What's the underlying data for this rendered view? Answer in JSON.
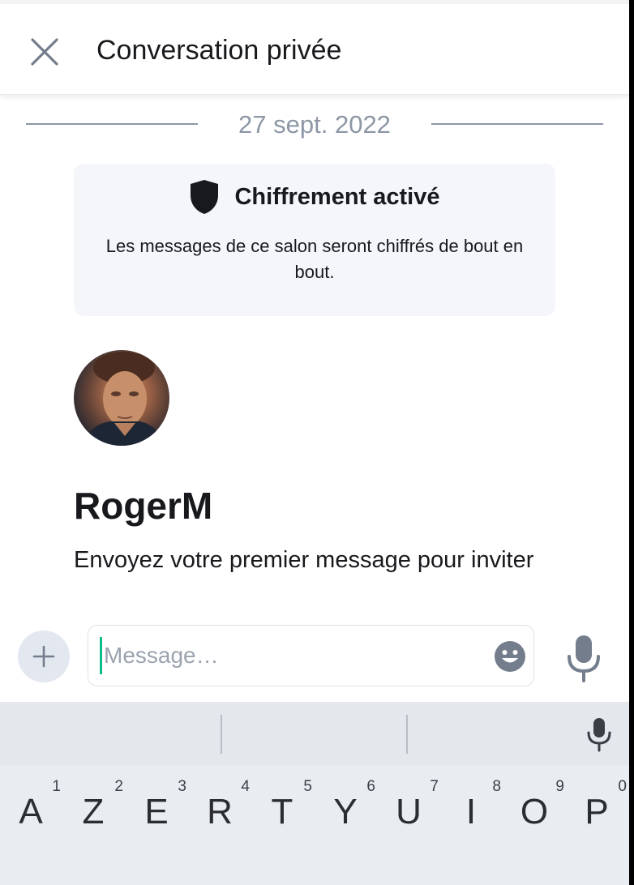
{
  "header": {
    "title": "Conversation privée",
    "close_icon": "close-icon"
  },
  "timeline": {
    "date": "27 sept. 2022",
    "encryption": {
      "title": "Chiffrement activé",
      "description": "Les messages de ce salon seront chiffrés de bout en bout.",
      "icon": "shield-icon"
    }
  },
  "contact": {
    "name": "RogerM",
    "invite_text": "Envoyez votre premier message pour inviter"
  },
  "composer": {
    "placeholder": "Message…",
    "value": "",
    "icons": [
      "plus-icon",
      "emoji-icon",
      "microphone-icon"
    ]
  },
  "keyboard": {
    "layout": "AZERTY",
    "keys": [
      {
        "letter": "A",
        "sup": "1"
      },
      {
        "letter": "Z",
        "sup": "2"
      },
      {
        "letter": "E",
        "sup": "3"
      },
      {
        "letter": "R",
        "sup": "4"
      },
      {
        "letter": "T",
        "sup": "5"
      },
      {
        "letter": "Y",
        "sup": "6"
      },
      {
        "letter": "U",
        "sup": "7"
      },
      {
        "letter": "I",
        "sup": "8"
      },
      {
        "letter": "O",
        "sup": "9"
      },
      {
        "letter": "P",
        "sup": "0"
      }
    ]
  },
  "colors": {
    "accent": "#0dbd8b",
    "muted": "#8d97a5",
    "text": "#17191c"
  }
}
